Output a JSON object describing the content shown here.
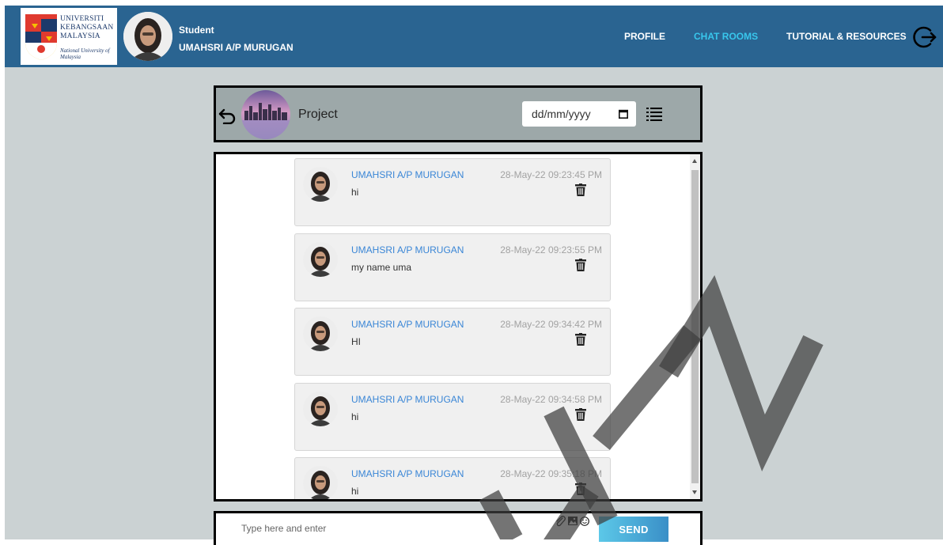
{
  "header": {
    "logo": {
      "lines": [
        "Universiti",
        "Kebangsaan",
        "Malaysia"
      ],
      "sub": "National University of Malaysia"
    },
    "user_role": "Student",
    "user_name": "UMAHSRI A/P MURUGAN",
    "nav": [
      {
        "label": "PROFILE",
        "active": false
      },
      {
        "label": "CHAT ROOMS",
        "active": true
      },
      {
        "label": "TUTORIAL & RESOURCES",
        "active": false
      }
    ],
    "logout_icon": "logout-icon"
  },
  "room": {
    "name": "Project",
    "date_placeholder": "dd/mm/yyyy"
  },
  "messages": [
    {
      "sender": "UMAHSRI A/P MURUGAN",
      "time": "28-May-22 09:23:45 PM",
      "text": "hi"
    },
    {
      "sender": "UMAHSRI A/P MURUGAN",
      "time": "28-May-22 09:23:55 PM",
      "text": "my name uma"
    },
    {
      "sender": "UMAHSRI A/P MURUGAN",
      "time": "28-May-22 09:34:42 PM",
      "text": "HI"
    },
    {
      "sender": "UMAHSRI A/P MURUGAN",
      "time": "28-May-22 09:34:58 PM",
      "text": "hi"
    },
    {
      "sender": "UMAHSRI A/P MURUGAN",
      "time": "28-May-22 09:35:18 PM",
      "text": "hi"
    }
  ],
  "compose": {
    "placeholder": "Type here and enter",
    "send_label": "SEND",
    "icons": [
      "attach-icon",
      "image-icon",
      "emoji-icon"
    ]
  },
  "watermark": "UTM",
  "colors": {
    "topbar": "#2a6491",
    "active_nav": "#38c6ec",
    "sender_name": "#3a86d6"
  }
}
